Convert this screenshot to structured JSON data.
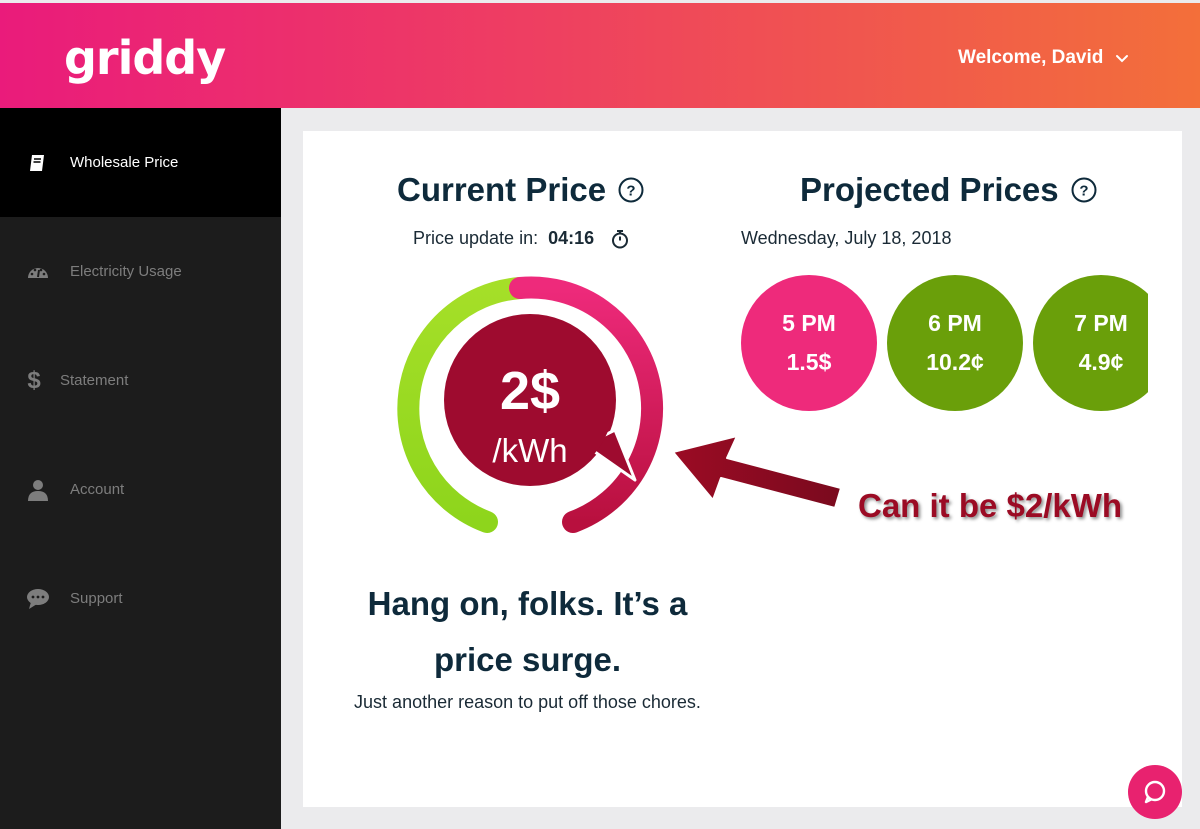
{
  "header": {
    "logo": "griddy",
    "welcome": "Welcome, David",
    "gradient_start": "#ea1b7b",
    "gradient_end": "#f36f3a"
  },
  "sidebar": {
    "items": [
      {
        "label": "Wholesale Price",
        "icon": "book-icon",
        "active": true
      },
      {
        "label": "Electricity Usage",
        "icon": "dashboard-gauge-icon",
        "active": false
      },
      {
        "label": "Statement",
        "icon": "dollar-icon",
        "active": false
      },
      {
        "label": "Account",
        "icon": "user-icon",
        "active": false
      },
      {
        "label": "Support",
        "icon": "chat-bubble-icon",
        "active": false
      }
    ]
  },
  "current": {
    "title": "Current Price",
    "update_label": "Price update in:",
    "timer": "04:16",
    "price": "2$",
    "unit": "/kWh",
    "gauge_colors": {
      "low": "#8ed51c",
      "high": "#d81b60",
      "bubble": "#9e0b2f"
    }
  },
  "projected": {
    "title": "Projected Prices",
    "date": "Wednesday, July 18, 2018",
    "slots": [
      {
        "time": "5 PM",
        "price": "1.5$",
        "color": "#ee2a7b"
      },
      {
        "time": "6 PM",
        "price": "10.2¢",
        "color": "#6a9f0a"
      },
      {
        "time": "7 PM",
        "price": "4.9¢",
        "color": "#6a9f0a"
      }
    ]
  },
  "annotation": {
    "text": "Can it be $2/kWh",
    "color": "#9b0b24"
  },
  "message": {
    "headline": "Hang on, folks. It’s a price surge.",
    "sub": "Just another reason to put off those chores."
  },
  "chat": {
    "icon": "chat-icon",
    "color": "#e8226f"
  }
}
